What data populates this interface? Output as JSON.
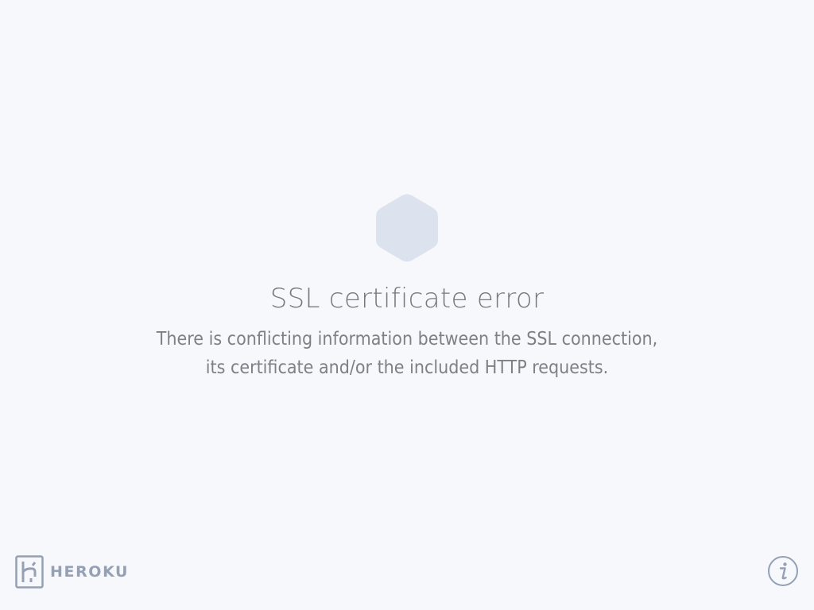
{
  "error": {
    "title": "SSL certificate error",
    "message": "There is conflicting information between the SSL connection, its certificate and/or the included HTTP requests."
  },
  "footer": {
    "brand_name": "HEROKU",
    "logo_icon": "heroku-logo-icon",
    "info_icon": "info-icon"
  },
  "colors": {
    "background": "#f6f8fb",
    "hexagon": "#dde3ee",
    "title_text": "#757a80",
    "body_text": "#7d8187",
    "brand": "#95a0b5"
  }
}
